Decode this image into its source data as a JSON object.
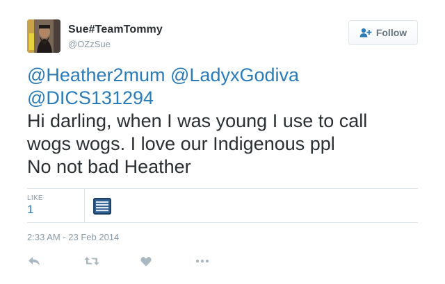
{
  "user": {
    "display_name": "Sue#TeamTommy",
    "handle": "@OZzSue"
  },
  "follow_button": {
    "label": "Follow",
    "icon": "add-user-icon"
  },
  "tweet": {
    "mentions": [
      "@Heather2mum",
      "@LadyxGodiva",
      "@DICS131294"
    ],
    "text_lines": [
      "Hi darling, when I was young I use to call",
      "wogs wogs. I love our Indigenous ppl",
      "No not bad Heather"
    ]
  },
  "stats": {
    "like_label": "LIKE",
    "like_count": "1"
  },
  "timestamp": "2:33 AM - 23 Feb 2014",
  "actions": [
    "reply-icon",
    "retweet-icon",
    "like-heart-icon",
    "more-options-icon"
  ],
  "colors": {
    "link": "#2b7bb9",
    "text": "#292f33",
    "muted": "#8899a6",
    "action_icon": "#aab8c2",
    "divider": "#e1e8ed"
  }
}
